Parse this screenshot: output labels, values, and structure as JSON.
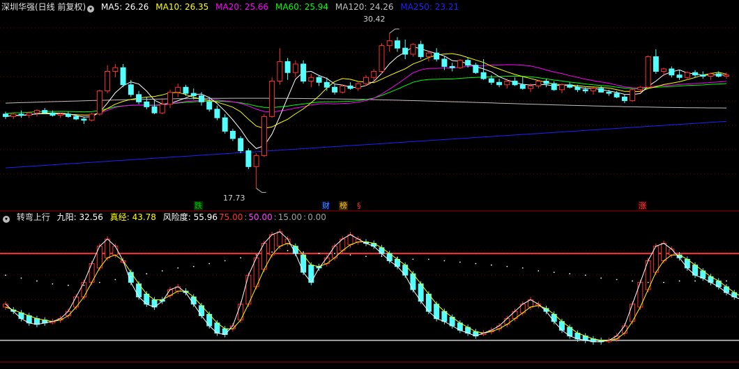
{
  "header": {
    "stock": "深圳华强(日线 前复权)",
    "ma": [
      {
        "label": "MA5: 26.26",
        "color": "#ffffff"
      },
      {
        "label": "MA10: 26.35",
        "color": "#ffff00"
      },
      {
        "label": "MA20: 25.66",
        "color": "#ff00ff"
      },
      {
        "label": "MA60: 25.94",
        "color": "#00ff00"
      },
      {
        "label": "MA120: 24.26",
        "color": "#c0c0c0"
      },
      {
        "label": "MA250: 23.21",
        "color": "#2020ff"
      }
    ]
  },
  "indicator_header": {
    "name": "转弯上行",
    "items": [
      {
        "label": "九阳: 32.56",
        "color": "#ffffff"
      },
      {
        "label": "真经: 43.78",
        "color": "#ffff00"
      },
      {
        "label": "风险度: 55.96",
        "color": "#ffffff"
      },
      {
        "label": "75.00",
        "color": "#ff3030"
      },
      {
        "label": "50.00",
        "color": "#ff40ff"
      },
      {
        "label": "15.00",
        "color": "#a0a0a0"
      },
      {
        "label": "0.00",
        "color": "#a0a0a0"
      }
    ]
  },
  "annotations": {
    "high": "30.42",
    "low": "17.73"
  },
  "badges": [
    {
      "text": "跌",
      "color": "#00c000",
      "bg": "#003300"
    },
    {
      "text": "财",
      "color": "#40a0ff",
      "bg": "#000033"
    },
    {
      "text": "榜",
      "color": "#ffcc00",
      "bg": "#332200"
    },
    {
      "text": "§",
      "color": "#ff3030",
      "bg": "#000000"
    },
    {
      "text": "涨",
      "color": "#ff4040",
      "bg": "#330000"
    }
  ],
  "chart_data": [
    {
      "type": "candlestick",
      "title": "深圳华强(日线 前复权)",
      "ylim": [
        16.5,
        32
      ],
      "up_color": "#ff3030",
      "down_color": "#54ffff",
      "candles": [
        [
          23.8,
          24.0,
          23.4,
          23.6
        ],
        [
          23.6,
          23.9,
          23.4,
          23.8
        ],
        [
          23.8,
          24.1,
          23.5,
          23.7
        ],
        [
          23.7,
          24.0,
          23.5,
          23.9
        ],
        [
          23.9,
          24.2,
          23.6,
          24.1
        ],
        [
          24.1,
          24.3,
          23.8,
          23.9
        ],
        [
          23.9,
          24.1,
          23.6,
          23.7
        ],
        [
          23.7,
          23.9,
          23.5,
          23.8
        ],
        [
          23.8,
          24.0,
          23.5,
          23.6
        ],
        [
          23.6,
          23.8,
          23.3,
          23.4
        ],
        [
          23.4,
          23.6,
          23.0,
          23.3
        ],
        [
          23.3,
          23.9,
          23.2,
          23.8
        ],
        [
          23.8,
          25.8,
          23.7,
          25.7
        ],
        [
          25.7,
          27.8,
          25.5,
          27.3
        ],
        [
          27.3,
          27.9,
          26.8,
          27.6
        ],
        [
          27.6,
          27.9,
          26.0,
          26.2
        ],
        [
          26.2,
          26.6,
          25.2,
          25.4
        ],
        [
          25.4,
          25.7,
          24.6,
          24.8
        ],
        [
          24.8,
          25.2,
          24.2,
          24.4
        ],
        [
          24.4,
          24.9,
          23.8,
          23.9
        ],
        [
          23.9,
          25.1,
          23.8,
          24.6
        ],
        [
          24.6,
          25.8,
          24.3,
          25.6
        ],
        [
          25.6,
          26.3,
          25.2,
          26.0
        ],
        [
          26.0,
          26.2,
          25.3,
          25.5
        ],
        [
          25.5,
          25.9,
          25.0,
          25.3
        ],
        [
          25.3,
          25.6,
          24.5,
          24.8
        ],
        [
          24.8,
          25.2,
          24.0,
          24.2
        ],
        [
          24.2,
          24.5,
          23.3,
          23.5
        ],
        [
          23.5,
          23.8,
          22.2,
          22.4
        ],
        [
          22.4,
          22.6,
          21.6,
          21.8
        ],
        [
          21.8,
          22.0,
          20.6,
          20.8
        ],
        [
          20.8,
          21.0,
          19.3,
          19.5
        ],
        [
          19.5,
          20.6,
          17.73,
          20.4
        ],
        [
          20.4,
          23.8,
          20.3,
          23.6
        ],
        [
          23.6,
          26.8,
          23.5,
          26.5
        ],
        [
          26.5,
          29.2,
          26.2,
          28.1
        ],
        [
          28.1,
          28.4,
          26.6,
          27.2
        ],
        [
          27.2,
          28.2,
          26.8,
          27.9
        ],
        [
          27.9,
          28.2,
          26.3,
          26.5
        ],
        [
          26.5,
          27.1,
          26.0,
          26.8
        ],
        [
          26.8,
          27.0,
          26.1,
          26.4
        ],
        [
          26.4,
          26.8,
          25.7,
          26.0
        ],
        [
          26.0,
          26.3,
          25.4,
          25.6
        ],
        [
          25.6,
          26.2,
          25.5,
          26.1
        ],
        [
          26.1,
          26.4,
          25.8,
          25.9
        ],
        [
          25.9,
          26.4,
          25.7,
          26.3
        ],
        [
          26.3,
          27.0,
          26.1,
          26.8
        ],
        [
          26.8,
          27.5,
          26.5,
          27.3
        ],
        [
          27.3,
          29.6,
          27.1,
          29.4
        ],
        [
          29.4,
          30.42,
          28.9,
          29.8
        ],
        [
          29.8,
          30.1,
          28.9,
          29.2
        ],
        [
          29.2,
          29.9,
          28.3,
          28.7
        ],
        [
          28.7,
          29.6,
          28.5,
          29.5
        ],
        [
          29.5,
          29.8,
          28.3,
          28.5
        ],
        [
          28.5,
          29.0,
          28.1,
          28.8
        ],
        [
          28.8,
          29.2,
          28.1,
          28.3
        ],
        [
          28.3,
          28.5,
          27.4,
          27.7
        ],
        [
          27.7,
          28.0,
          27.3,
          27.6
        ],
        [
          27.6,
          28.3,
          27.5,
          28.2
        ],
        [
          28.2,
          28.4,
          27.6,
          27.8
        ],
        [
          27.8,
          28.0,
          27.1,
          27.2
        ],
        [
          27.2,
          28.3,
          26.6,
          26.7
        ],
        [
          26.7,
          27.0,
          26.2,
          26.4
        ],
        [
          26.4,
          26.7,
          26.0,
          26.2
        ],
        [
          26.2,
          26.7,
          25.9,
          26.5
        ],
        [
          26.5,
          26.8,
          26.1,
          26.2
        ],
        [
          26.2,
          26.9,
          25.8,
          25.9
        ],
        [
          25.9,
          26.3,
          25.6,
          26.1
        ],
        [
          26.1,
          26.6,
          25.9,
          26.5
        ],
        [
          26.5,
          26.7,
          26.0,
          26.3
        ],
        [
          26.3,
          26.5,
          25.7,
          25.8
        ],
        [
          25.8,
          26.3,
          25.5,
          26.2
        ],
        [
          26.2,
          26.4,
          25.9,
          26.0
        ],
        [
          26.0,
          26.2,
          25.6,
          25.8
        ],
        [
          25.8,
          26.0,
          25.5,
          25.7
        ],
        [
          25.7,
          26.0,
          25.4,
          25.9
        ],
        [
          25.9,
          26.1,
          25.6,
          25.6
        ],
        [
          25.6,
          25.8,
          25.3,
          25.5
        ],
        [
          25.5,
          25.7,
          25.1,
          25.2
        ],
        [
          25.2,
          25.4,
          24.7,
          24.9
        ],
        [
          24.9,
          25.9,
          24.8,
          25.8
        ],
        [
          25.8,
          26.1,
          25.5,
          26.0
        ],
        [
          26.0,
          28.6,
          25.9,
          28.5
        ],
        [
          28.5,
          29.1,
          27.1,
          27.3
        ],
        [
          27.3,
          27.6,
          26.9,
          27.5
        ],
        [
          27.5,
          27.7,
          26.8,
          27.0
        ],
        [
          27.0,
          27.4,
          26.6,
          26.8
        ],
        [
          26.8,
          27.3,
          26.6,
          27.2
        ],
        [
          27.2,
          27.4,
          26.8,
          27.0
        ],
        [
          27.0,
          27.3,
          26.7,
          26.9
        ],
        [
          26.9,
          27.2,
          26.6,
          27.1
        ],
        [
          27.1,
          27.3,
          26.8,
          26.9
        ],
        [
          26.9,
          27.2,
          26.7,
          27.0
        ]
      ],
      "annotations": [
        {
          "text": "30.42",
          "index": 49,
          "value": 30.42
        },
        {
          "text": "17.73",
          "index": 32,
          "value": 17.73
        }
      ]
    },
    {
      "type": "candlestick",
      "title": "转弯上行",
      "ylim": [
        0,
        100
      ],
      "reference_lines": [
        {
          "value": 75.0,
          "color": "#ff3030"
        },
        {
          "value": 15.0,
          "color": "#a0a0a0"
        }
      ],
      "series": [
        {
          "name": "九阳",
          "color": "#ffffff",
          "values": [
            40,
            35,
            30,
            27,
            26,
            27,
            28,
            30,
            35,
            45,
            55,
            68,
            80,
            85,
            80,
            70,
            55,
            45,
            40,
            38,
            42,
            50,
            52,
            48,
            40,
            32,
            25,
            20,
            19,
            25,
            40,
            60,
            72,
            82,
            88,
            90,
            85,
            75,
            62,
            55,
            65,
            72,
            80,
            85,
            88,
            85,
            82,
            80,
            75,
            70,
            66,
            60,
            50,
            42,
            35,
            30,
            28,
            25,
            22,
            20,
            18,
            20,
            22,
            25,
            30,
            35,
            40,
            43,
            40,
            35,
            28,
            22,
            18,
            16,
            15,
            14,
            14,
            15,
            18,
            25,
            40,
            55,
            70,
            80,
            82,
            78,
            72,
            65,
            60,
            58,
            55,
            52,
            48,
            45,
            43
          ]
        },
        {
          "name": "真经",
          "color": "#ffff00",
          "values": [
            38,
            36,
            34,
            32,
            30,
            29,
            28,
            29,
            32,
            38,
            45,
            55,
            65,
            72,
            74,
            70,
            62,
            54,
            47,
            43,
            43,
            46,
            49,
            49,
            45,
            39,
            33,
            27,
            23,
            23,
            29,
            40,
            52,
            64,
            74,
            80,
            82,
            80,
            74,
            67,
            66,
            68,
            72,
            77,
            81,
            83,
            83,
            82,
            79,
            75,
            71,
            67,
            61,
            54,
            47,
            40,
            35,
            31,
            27,
            24,
            21,
            20,
            21,
            23,
            26,
            30,
            34,
            38,
            39,
            37,
            33,
            28,
            24,
            20,
            18,
            16,
            15,
            15,
            16,
            20,
            28,
            38,
            50,
            62,
            70,
            74,
            74,
            71,
            67,
            63,
            59,
            56,
            52,
            48,
            45
          ]
        },
        {
          "name": "风险度",
          "color": "#ffffff",
          "values": [
            60,
            59,
            58,
            57,
            56,
            55,
            54,
            54,
            53,
            53,
            53,
            54,
            55,
            56,
            57,
            58,
            59,
            60,
            61,
            62,
            63,
            64,
            65,
            66,
            66,
            67,
            68,
            69,
            70,
            71,
            72,
            73,
            74,
            75,
            76,
            77,
            77,
            77,
            76,
            76,
            75,
            75,
            75,
            74,
            74,
            74,
            73,
            73,
            73,
            72,
            72,
            72,
            71,
            71,
            71,
            70,
            70,
            69,
            69,
            68,
            68,
            67,
            67,
            66,
            66,
            65,
            65,
            64,
            63,
            63,
            62,
            62,
            61,
            60,
            60,
            59,
            58,
            58,
            57,
            57,
            56,
            56,
            55,
            55,
            55,
            55,
            56,
            56,
            56,
            56,
            56,
            56,
            56,
            56,
            56
          ]
        }
      ]
    }
  ]
}
